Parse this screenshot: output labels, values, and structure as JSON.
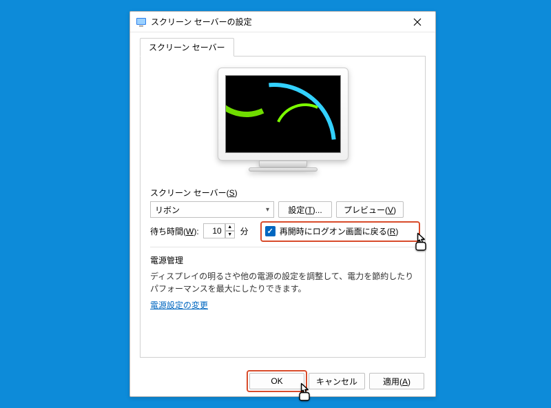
{
  "window": {
    "title": "スクリーン セーバーの設定"
  },
  "tabs": {
    "main": "スクリーン セーバー"
  },
  "screensaver": {
    "section_label_html": "スクリーン セーバー(<span class='underline'>S</span>)",
    "dropdown_value": "リボン",
    "settings_btn_html": "設定(<span class='underline'>T</span>)...",
    "preview_btn_html": "プレビュー(<span class='underline'>V</span>)"
  },
  "wait": {
    "label_html": "待ち時間(<span class='underline'>W</span>):",
    "minutes_value": "10",
    "minutes_unit": "分",
    "resume_checkbox_html": "再開時にログオン画面に戻る(<span class='underline'>R</span>)",
    "resume_checked": true
  },
  "power": {
    "heading": "電源管理",
    "description": "ディスプレイの明るさや他の電源の設定を調整して、電力を節約したりパフォーマンスを最大にしたりできます。",
    "link": "電源設定の変更"
  },
  "footer": {
    "ok": "OK",
    "cancel": "キャンセル",
    "apply_html": "適用(<span class='underline'>A</span>)"
  }
}
